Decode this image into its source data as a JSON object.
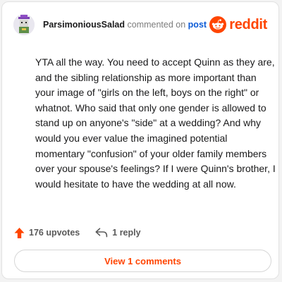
{
  "comment": {
    "author": "ParsimoniousSalad",
    "action_text": "commented on",
    "target_link": "post",
    "body": "YTA all the way. You need to accept Quinn as they are, and the sibling relationship as more important than your image of \"girls on the left, boys on the right\" or whatnot. Who said that only one gender is allowed to stand up on anyone's \"side\" at a wedding? And why would you ever value the imagined potential momentary \"confusion\" of your older family members over your spouse's feelings? If I were Quinn's brother, I would hesitate to have the wedding at all now."
  },
  "brand": {
    "wordmark": "reddit",
    "icon": "reddit-snoo-icon",
    "color": "#ff4500"
  },
  "footer": {
    "upvotes": "176 upvotes",
    "replies": "1 reply",
    "upvote_icon": "upvote-arrow-icon",
    "reply_icon": "reply-arrow-icon"
  },
  "view_comments_label": "View 1 comments",
  "colors": {
    "link_blue": "#0b5ad6",
    "accent_orange": "#ff4500",
    "text_dark": "#1a1a1b",
    "text_muted": "#7c7c7c"
  }
}
